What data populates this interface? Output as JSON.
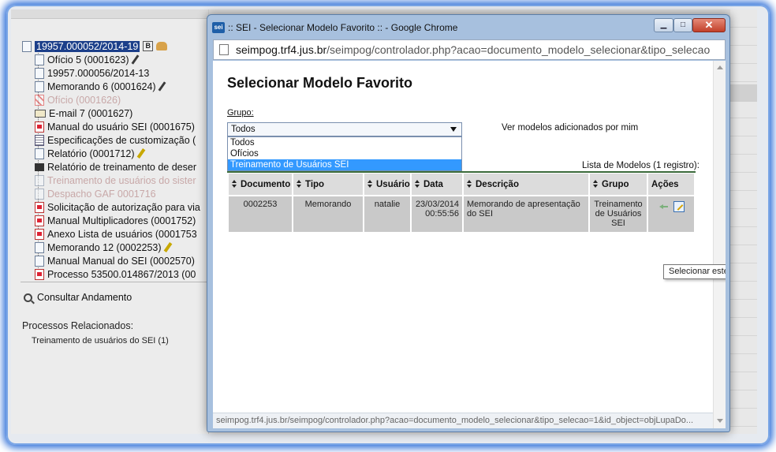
{
  "background": {
    "process_tree": {
      "root_label": "19957.000052/2014-19",
      "root_badge": "B",
      "items": [
        {
          "label": "Ofício 5 (0001623)",
          "icon": "document-icon",
          "pen": "black"
        },
        {
          "label": "19957.000056/2014-13",
          "icon": "process-link-icon",
          "pen": ""
        },
        {
          "label": "Memorando 6 (0001624)",
          "icon": "document-icon",
          "pen": "black"
        },
        {
          "label": "Ofício (0001626)",
          "icon": "cancelled-document-icon",
          "pen": "",
          "faded": true
        },
        {
          "label": "E-mail 7 (0001627)",
          "icon": "email-icon",
          "pen": ""
        },
        {
          "label": "Manual do usuário SEI (0001675)",
          "icon": "pdf-icon",
          "pen": ""
        },
        {
          "label": "Especificações de customização (",
          "icon": "spreadsheet-icon",
          "pen": ""
        },
        {
          "label": "Relatório (0001712)",
          "icon": "document-icon",
          "pen": "yellow"
        },
        {
          "label": "Relatório de treinamento de deser",
          "icon": "report-icon",
          "pen": ""
        },
        {
          "label": "Treinamento de usuários do sister",
          "icon": "document-icon",
          "pen": "",
          "faded": true
        },
        {
          "label": "Despacho GAF 0001716",
          "icon": "document-icon",
          "pen": "",
          "faded": true
        },
        {
          "label": "Solicitação de autorização para via",
          "icon": "pdf-icon",
          "pen": ""
        },
        {
          "label": "Manual Multiplicadores (0001752)",
          "icon": "pdf-icon",
          "pen": ""
        },
        {
          "label": "Anexo Lista de usuários (0001753",
          "icon": "pdf-icon",
          "pen": ""
        },
        {
          "label": "Memorando 12 (0002253)",
          "icon": "document-icon",
          "pen": "yellow"
        },
        {
          "label": "Manual Manual do SEI (0002570)",
          "icon": "document-icon",
          "pen": ""
        },
        {
          "label": "Processo 53500.014867/2013 (00",
          "icon": "pdf-icon",
          "pen": ""
        }
      ]
    },
    "consultar_andamento": "Consultar Andamento",
    "processos_relacionados": "Processos Relacionados:",
    "processo_relacionado_item": "Treinamento de usuários do SEI (1)"
  },
  "popup": {
    "logo_text": "sei",
    "window_title": ":: SEI - Selecionar Modelo Favorito :: - Google Chrome",
    "url_host": "seimpog.trf4.jus.br",
    "url_path": "/seimpog/controlador.php?acao=documento_modelo_selecionar&tipo_selecao",
    "page_title": "Selecionar Modelo Favorito",
    "grupo_label": "Grupo:",
    "grupo_selected": "Todos",
    "grupo_options": [
      "Todos",
      "Ofícios",
      "Treinamento de Usuários SEI"
    ],
    "grupo_highlighted_index": 2,
    "ver_modelos_link": "Ver modelos adicionados por mim",
    "list_caption": "Lista de Modelos (1 registro):",
    "table": {
      "headers": [
        "Documento",
        "Tipo",
        "Usuário",
        "Data",
        "Descrição",
        "Grupo",
        "Ações"
      ],
      "rows": [
        {
          "documento": "0002253",
          "tipo": "Memorando",
          "usuario": "natalie",
          "data": "23/03/2014",
          "hora": "00:55:56",
          "descricao": "Memorando de apresentação do SEI",
          "grupo": "Treinamento de Usuários SEI"
        }
      ]
    },
    "tooltip": "Selecionar este Modelo",
    "status_url": "seimpog.trf4.jus.br/seimpog/controlador.php?acao=documento_modelo_selecionar&tipo_selecao=1&id_object=objLupaDo..."
  }
}
